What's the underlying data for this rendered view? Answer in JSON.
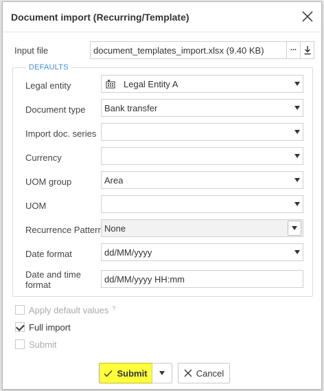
{
  "dialog": {
    "title": "Document import (Recurring/Template)"
  },
  "input_file": {
    "label": "Input file",
    "value": "document_templates_import.xlsx (9.40 KB)",
    "browse_label": "...",
    "download_icon": "download-icon"
  },
  "defaults": {
    "legend": "DEFAULTS",
    "legal_entity": {
      "label": "Legal entity",
      "value": "Legal Entity A",
      "icon": "building-icon"
    },
    "document_type": {
      "label": "Document type",
      "value": "Bank transfer"
    },
    "import_doc_series": {
      "label": "Import doc. series",
      "value": ""
    },
    "currency": {
      "label": "Currency",
      "value": ""
    },
    "uom_group": {
      "label": "UOM group",
      "value": "Area"
    },
    "uom": {
      "label": "UOM",
      "value": ""
    },
    "recurrence_pattern": {
      "label": "Recurrence Pattern",
      "value": "None"
    },
    "date_format": {
      "label": "Date format",
      "value": "dd/MM/yyyy"
    },
    "date_time_format": {
      "label_line1": "Date and time",
      "label_line2": "format",
      "value": "dd/MM/yyyy HH:mm"
    }
  },
  "options": {
    "apply_default_values": {
      "label": "Apply default values",
      "help": "?",
      "checked": false,
      "disabled": true
    },
    "full_import": {
      "label": "Full import",
      "checked": true,
      "disabled": false
    },
    "submit": {
      "label": "Submit",
      "checked": false,
      "disabled": true
    }
  },
  "buttons": {
    "submit_label": "Submit",
    "cancel_label": "Cancel"
  },
  "colors": {
    "accent": "#3a8fd6",
    "submit_highlight": "#ffff3a"
  }
}
